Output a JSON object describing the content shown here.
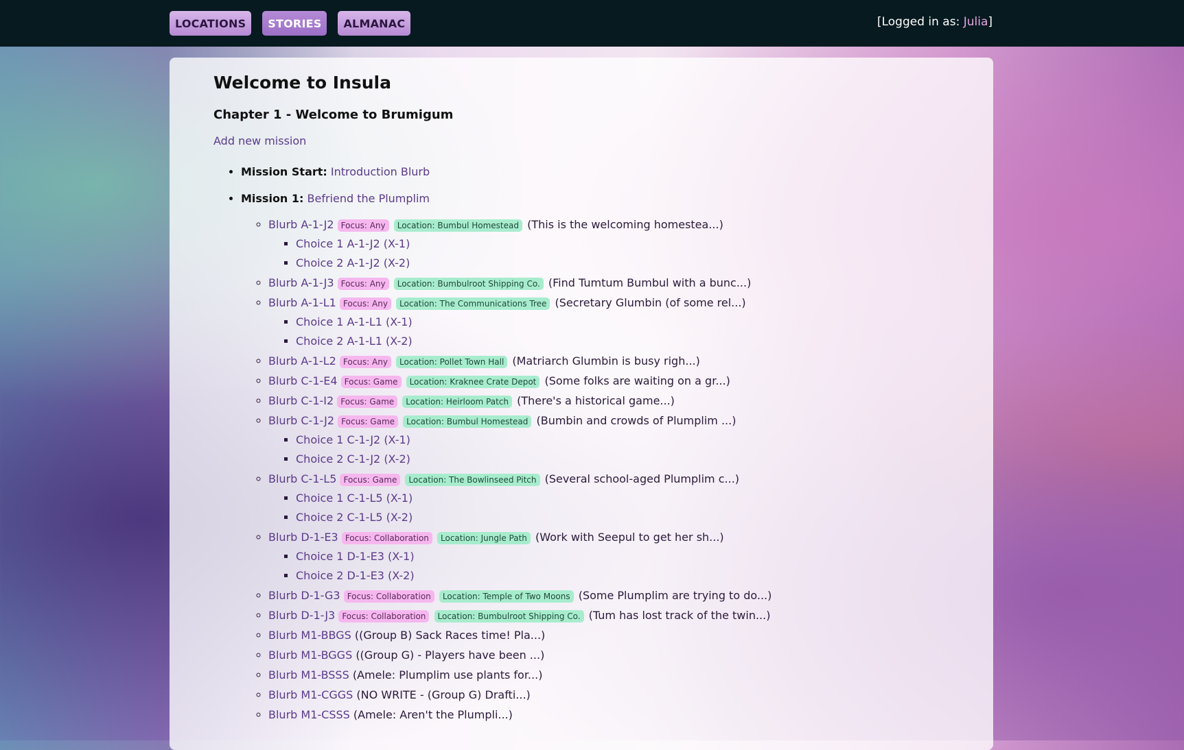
{
  "nav": {
    "items": [
      {
        "label": "LOCATIONS",
        "active": false
      },
      {
        "label": "STORIES",
        "active": true
      },
      {
        "label": "ALMANAC",
        "active": false
      }
    ],
    "login_prefix": "[Logged in as: ",
    "login_user": "Julia",
    "login_suffix": "]"
  },
  "page": {
    "title": "Welcome to Insula",
    "chapter": "Chapter 1 - Welcome to Brumigum",
    "add_mission": "Add new mission"
  },
  "missions": [
    {
      "label": "Mission Start:",
      "name": "Introduction Blurb"
    },
    {
      "label": "Mission 1:",
      "name": "Befriend the Plumplim"
    }
  ],
  "blurbs": [
    {
      "name": "Blurb A-1-J2",
      "focus": "Focus: Any",
      "location": "Location: Bumbul Homestead",
      "summary": "(This is the welcoming homestea...)",
      "choices": [
        "Choice 1 A-1-J2 (X-1)",
        "Choice 2 A-1-J2 (X-2)"
      ]
    },
    {
      "name": "Blurb A-1-J3",
      "focus": "Focus: Any",
      "location": "Location: Bumbulroot Shipping Co.",
      "summary": "(Find Tumtum Bumbul with a bunc...)",
      "choices": []
    },
    {
      "name": "Blurb A-1-L1",
      "focus": "Focus: Any",
      "location": "Location: The Communications Tree",
      "summary": "(Secretary Glumbin (of some rel...)",
      "choices": [
        "Choice 1 A-1-L1 (X-1)",
        "Choice 2 A-1-L1 (X-2)"
      ]
    },
    {
      "name": "Blurb A-1-L2",
      "focus": "Focus: Any",
      "location": "Location: Pollet Town Hall",
      "summary": "(Matriarch Glumbin is busy righ...)",
      "choices": []
    },
    {
      "name": "Blurb C-1-E4",
      "focus": "Focus: Game",
      "location": "Location: Kraknee Crate Depot",
      "summary": "(Some folks are waiting on a gr...)",
      "choices": []
    },
    {
      "name": "Blurb C-1-I2",
      "focus": "Focus: Game",
      "location": "Location: Heirloom Patch",
      "summary": "(There's a historical game...)",
      "choices": []
    },
    {
      "name": "Blurb C-1-J2",
      "focus": "Focus: Game",
      "location": "Location: Bumbul Homestead",
      "summary": "(Bumbin and crowds of Plumplim ...)",
      "choices": [
        "Choice 1 C-1-J2 (X-1)",
        "Choice 2 C-1-J2 (X-2)"
      ]
    },
    {
      "name": "Blurb C-1-L5",
      "focus": "Focus: Game",
      "location": "Location: The Bowlinseed Pitch",
      "summary": "(Several school-aged Plumplim c...)",
      "choices": [
        "Choice 1 C-1-L5 (X-1)",
        "Choice 2 C-1-L5 (X-2)"
      ]
    },
    {
      "name": "Blurb D-1-E3",
      "focus": "Focus: Collaboration",
      "location": "Location: Jungle Path",
      "summary": "(Work with Seepul to get her sh...)",
      "choices": [
        "Choice 1 D-1-E3 (X-1)",
        "Choice 2 D-1-E3 (X-2)"
      ]
    },
    {
      "name": "Blurb D-1-G3",
      "focus": "Focus: Collaboration",
      "location": "Location: Temple of Two Moons",
      "summary": "(Some Plumplim are trying to do...)",
      "choices": []
    },
    {
      "name": "Blurb D-1-J3",
      "focus": "Focus: Collaboration",
      "location": "Location: Bumbulroot Shipping Co.",
      "summary": "(Tum has lost track of the twin...)",
      "choices": []
    },
    {
      "name": "Blurb M1-BBGS",
      "focus": "",
      "location": "",
      "summary": "((Group B) Sack Races time! Pla...)",
      "choices": []
    },
    {
      "name": "Blurb M1-BGGS",
      "focus": "",
      "location": "",
      "summary": "((Group G) - Players have been ...)",
      "choices": []
    },
    {
      "name": "Blurb M1-BSSS",
      "focus": "",
      "location": "",
      "summary": "(Amele: Plumplim use plants for...)",
      "choices": []
    },
    {
      "name": "Blurb M1-CGGS",
      "focus": "",
      "location": "",
      "summary": "(NO WRITE - (Group G) Drafti...)",
      "choices": []
    },
    {
      "name": "Blurb M1-CSSS",
      "focus": "",
      "location": "",
      "summary": "(Amele: Aren't the Plumpli...)",
      "choices": []
    }
  ]
}
